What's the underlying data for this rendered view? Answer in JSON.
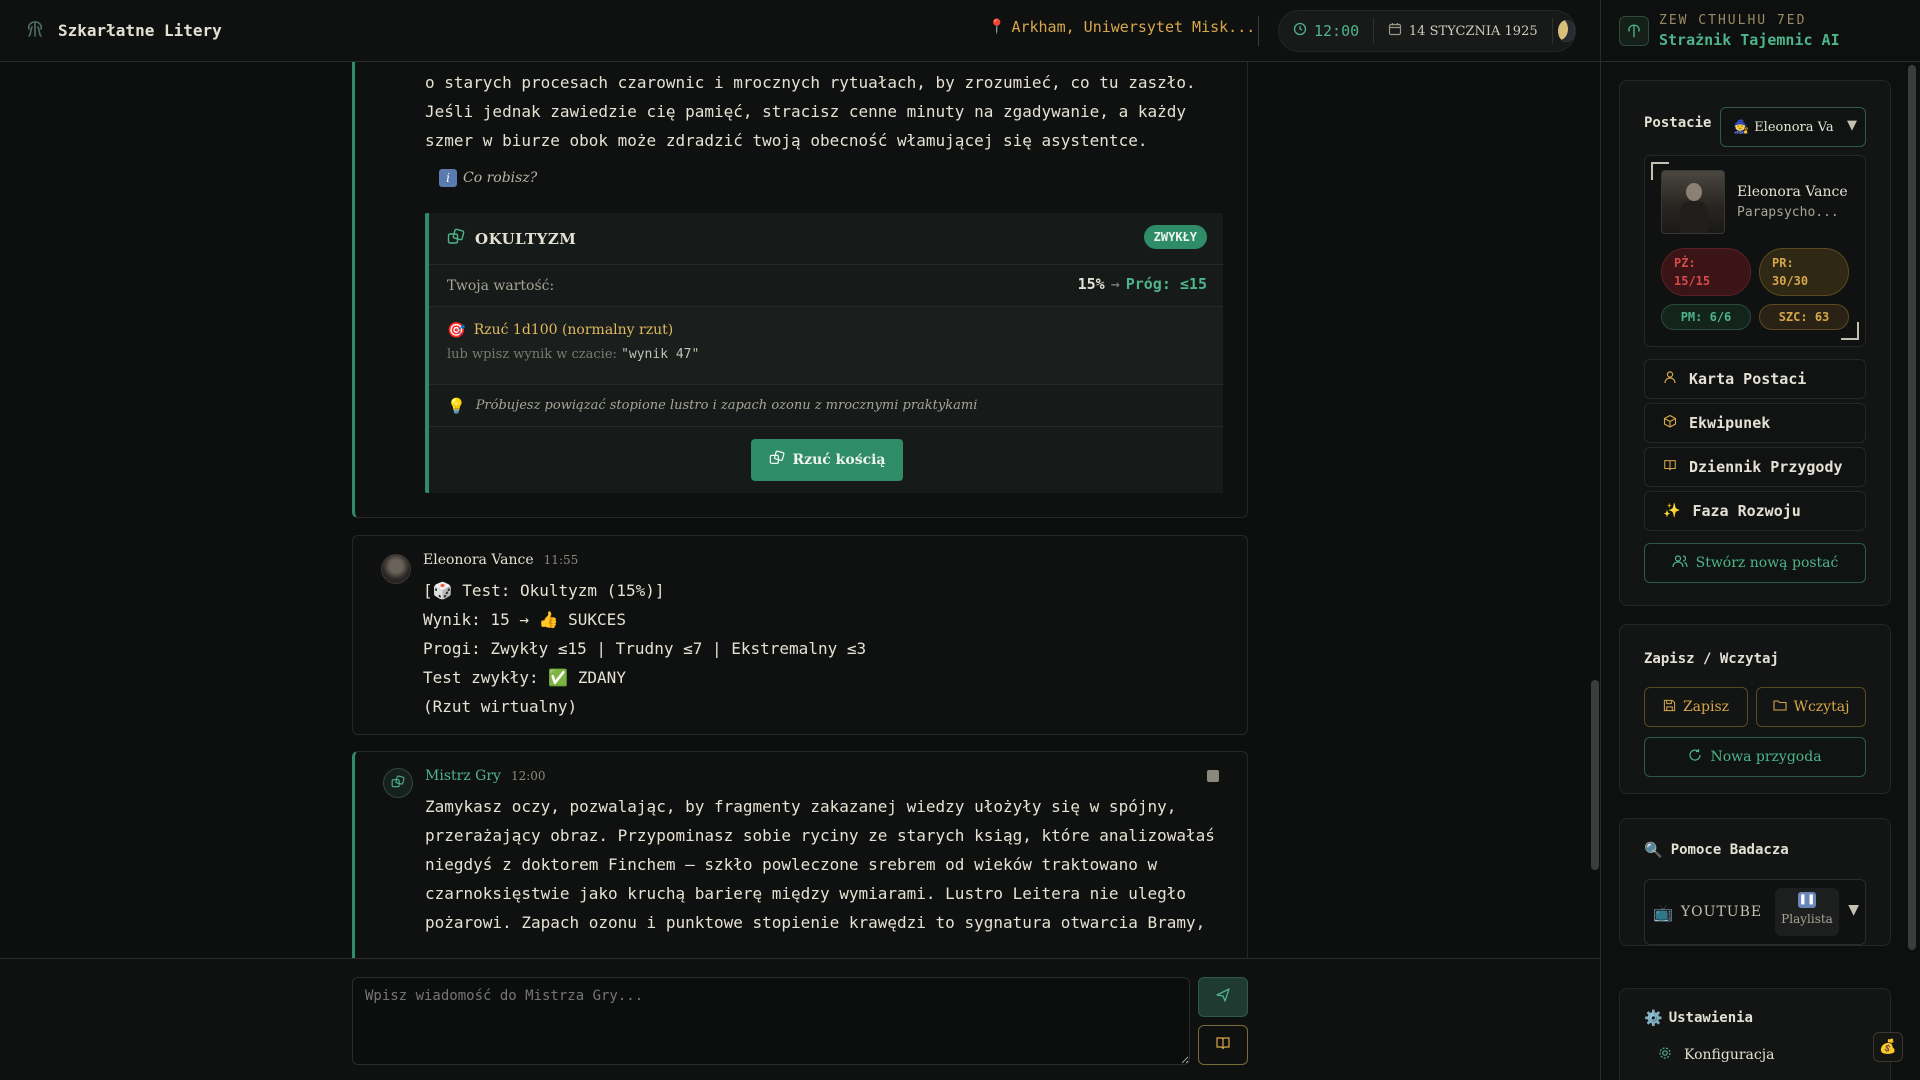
{
  "header": {
    "title": "Szkarłatne Litery",
    "location": "Arkham, Uniwersytet Misk...",
    "time": "12:00",
    "date": "14 STYCZNIA 1925"
  },
  "chat": {
    "top_message": {
      "lines": [
        "o starych procesach czarownic i mrocznych rytuałach, by zrozumieć, co tu zaszło.",
        "Jeśli jednak zawiedzie cię pamięć, stracisz cenne minuty na zgadywanie, a każdy",
        "szmer w biurze obok może zdradzić twoją obecność włamującej się asystentce."
      ],
      "prompt": "Co robisz?",
      "skill_check": {
        "skill": "OKULTYZM",
        "difficulty": "ZWYKŁY",
        "value_label": "Twoja wartość:",
        "value": "15%",
        "arrow": "→",
        "threshold": "Próg: ≤15",
        "roll_label": "Rzuć 1d100 (normalny rzut)",
        "hint_prefix": "lub wpisz wynik w czacie:",
        "hint_example": "\"wynik 47\"",
        "note": "Próbujesz powiązać stopione lustro i zapach ozonu z mrocznymi praktykami",
        "roll_button": "Rzuć kością"
      }
    },
    "player_message": {
      "author": "Eleonora Vance",
      "time": "11:55",
      "lines": [
        "[🎲 Test: Okultyzm (15%)]",
        "Wynik: 15 → 👍 SUKCES",
        "Progi: Zwykły ≤15 | Trudny ≤7 | Ekstremalny ≤3",
        "Test zwykły: ✅ ZDANY",
        "(Rzut wirtualny)"
      ]
    },
    "gm_message": {
      "author": "Mistrz Gry",
      "time": "12:00",
      "lines": [
        "Zamykasz oczy, pozwalając, by fragmenty zakazanej wiedzy ułożyły się w spójny,",
        "przerażający obraz. Przypominasz sobie ryciny ze starych ksiąg, które analizowałaś",
        "niegdyś z doktorem Finchem – szkło powleczone srebrem od wieków traktowano w",
        "czarnoksięstwie jako kruchą barierę między wymiarami. Lustro Leitera nie uległo",
        "pożarowi. Zapach ozonu i punktowe stopienie krawędzi to sygnatura otwarcia Bramy,"
      ]
    }
  },
  "input": {
    "placeholder": "Wpisz wiadomość do Mistrza Gry..."
  },
  "sidebar": {
    "subtitle": "ZEW CTHULHU 7ED",
    "title": "Strażnik Tajemnic AI",
    "characters_label": "Postacie",
    "character_select": "Eleonora Va",
    "character": {
      "name": "Eleonora Vance",
      "profession": "Parapsycho...",
      "hp": "PŻ: 15/15",
      "sanity": "PR: 30/30",
      "mp": "PM: 6/6",
      "luck": "SZC: 63"
    },
    "nav": [
      "Karta Postaci",
      "Ekwipunek",
      "Dziennik Przygody",
      "Faza Rozwoju"
    ],
    "create_character": "Stwórz nową postać",
    "save_section": "Zapisz / Wczytaj",
    "save": "Zapisz",
    "load": "Wczytaj",
    "new_adventure": "Nowa przygoda",
    "aids_title": "Pomoce Badacza",
    "youtube": "YOUTUBE",
    "playlist": "Playlista",
    "settings_title": "Ustawienia",
    "config": "Konfiguracja"
  },
  "colors": {
    "accent_green": "#4fb38c",
    "accent_gold": "#d7a64a",
    "background": "#0d0f0e"
  }
}
